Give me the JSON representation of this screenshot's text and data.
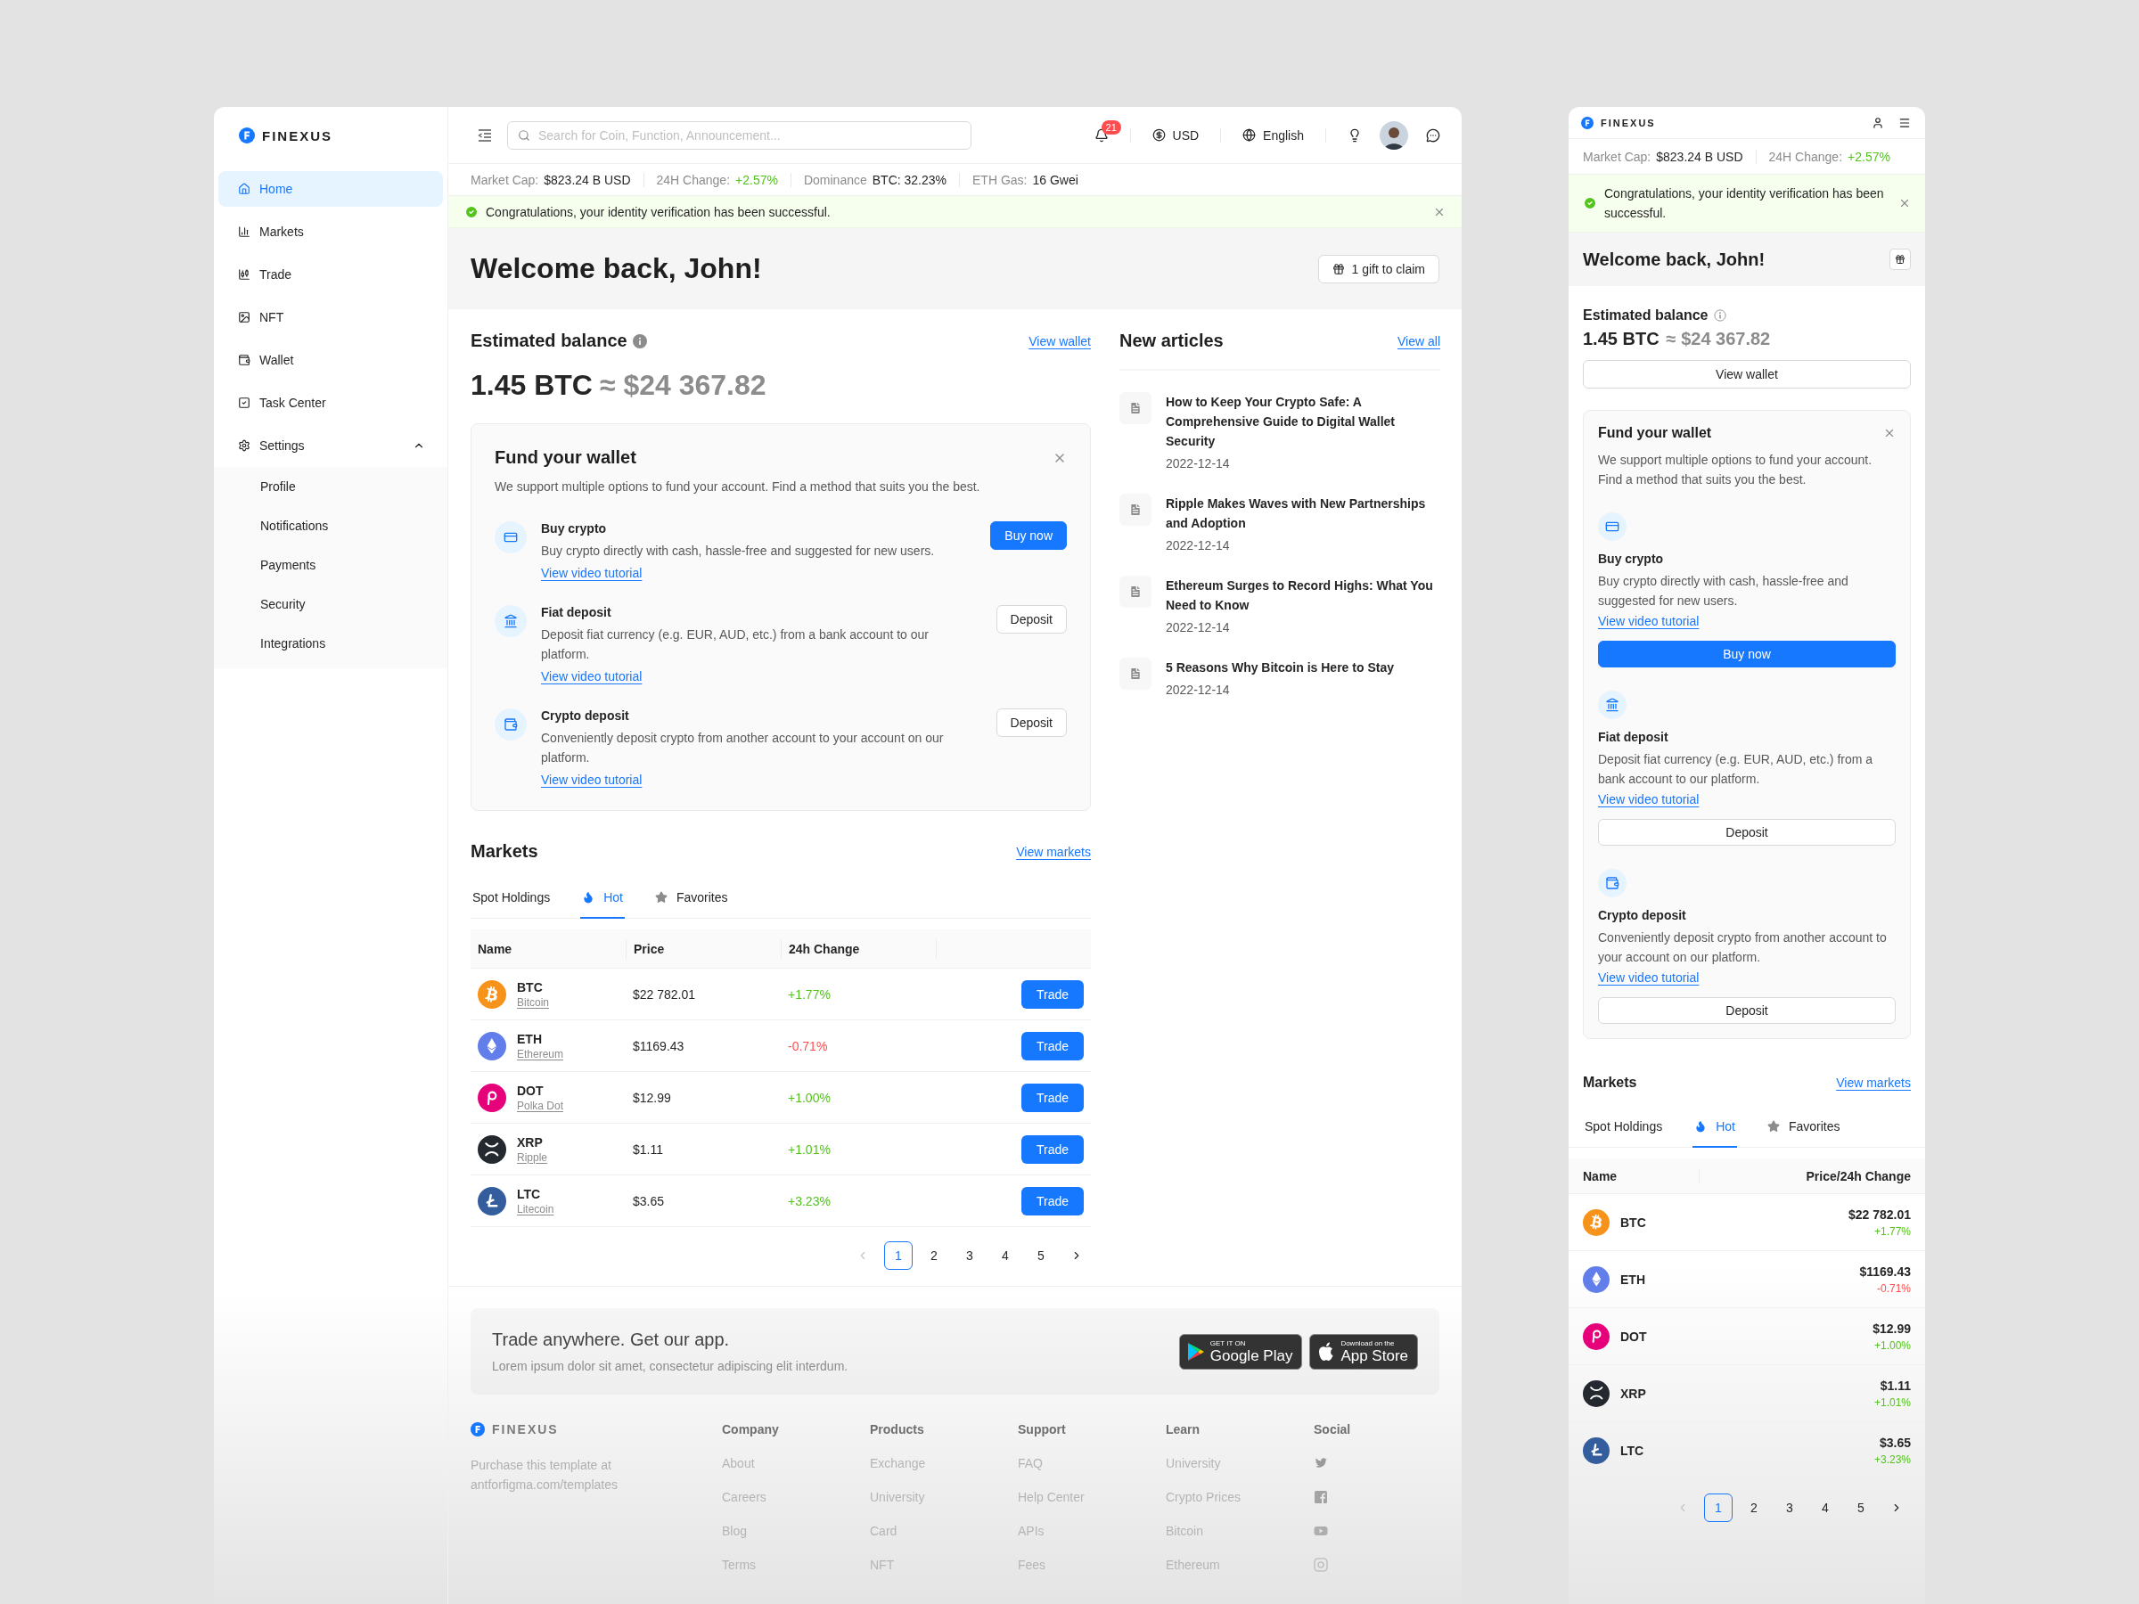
{
  "brand": {
    "name": "FINEXUS"
  },
  "sidebar": {
    "items": [
      {
        "label": "Home",
        "selected": true
      },
      {
        "label": "Markets",
        "selected": false
      },
      {
        "label": "Trade",
        "selected": false
      },
      {
        "label": "NFT",
        "selected": false
      },
      {
        "label": "Wallet",
        "selected": false
      },
      {
        "label": "Task Center",
        "selected": false
      },
      {
        "label": "Settings",
        "selected": false,
        "expanded": true,
        "children": [
          {
            "label": "Profile",
            "selected": false
          },
          {
            "label": "Notifications",
            "selected": false
          },
          {
            "label": "Payments",
            "selected": false
          },
          {
            "label": "Security",
            "selected": false
          },
          {
            "label": "Integrations",
            "selected": false
          }
        ]
      }
    ]
  },
  "header": {
    "search": {
      "placeholder": "Search for Coin, Function, Announcement..."
    },
    "notification_count": "21",
    "currency": "USD",
    "language": "English"
  },
  "ticker": [
    {
      "label": "Market Cap:",
      "value": "$823.24 B USD",
      "kind": "neutral"
    },
    {
      "label": "24H Change:",
      "value": "+2.57%",
      "kind": "up"
    },
    {
      "label": "Dominance",
      "value": "BTC:  32.23%",
      "kind": "neutral"
    },
    {
      "label": "ETH Gas:",
      "value": "16 Gwei",
      "kind": "neutral"
    }
  ],
  "alert": {
    "message": "Congratulations, your identity verification has been successful."
  },
  "welcome": {
    "title": "Welcome back, John!",
    "gift_button": "1 gift to claim"
  },
  "balance": {
    "title": "Estimated balance",
    "link": "View wallet",
    "crypto": "1.45 BTC",
    "approx": "≈",
    "fiat": "$24 367.82"
  },
  "fund": {
    "title": "Fund your wallet",
    "description": "We support multiple options to fund your account. Find a method that suits you the best.",
    "methods": [
      {
        "title": "Buy crypto",
        "description": "Buy crypto directly with cash, hassle-free and suggested for new users.",
        "link": "View video tutorial",
        "button": "Buy now",
        "primary": true
      },
      {
        "title": "Fiat deposit",
        "description": "Deposit fiat currency (e.g. EUR, AUD, etc.) from a bank account to our platform.",
        "link": "View video tutorial",
        "button": "Deposit",
        "primary": false
      },
      {
        "title": "Crypto deposit",
        "description": "Conveniently deposit crypto from another account to your account on our platform.",
        "link": "View video tutorial",
        "button": "Deposit",
        "primary": false
      }
    ]
  },
  "articles": {
    "title": "New articles",
    "link": "View all",
    "items": [
      {
        "title": "How to Keep Your Crypto Safe: A Comprehensive Guide to Digital Wallet Security",
        "date": "2022-12-14"
      },
      {
        "title": "Ripple Makes Waves with New Partnerships and Adoption",
        "date": "2022-12-14"
      },
      {
        "title": "Ethereum Surges to Record Highs: What You Need to Know",
        "date": "2022-12-14"
      },
      {
        "title": "5 Reasons Why Bitcoin is Here to Stay",
        "date": "2022-12-14"
      }
    ]
  },
  "markets": {
    "title": "Markets",
    "link": "View markets",
    "tabs": [
      {
        "label": "Spot Holdings",
        "selected": false
      },
      {
        "label": "Hot",
        "selected": true
      },
      {
        "label": "Favorites",
        "selected": false
      }
    ],
    "columns": [
      "Name",
      "Price",
      "24h Change"
    ],
    "rows": [
      {
        "symbol": "BTC",
        "name": "Bitcoin",
        "price": "$22 782.01",
        "change": "+1.77%",
        "kind": "up",
        "color": "#f7931a",
        "action": "Trade"
      },
      {
        "symbol": "ETH",
        "name": "Ethereum",
        "price": "$1169.43",
        "change": "-0.71%",
        "kind": "down",
        "color": "#627eea",
        "action": "Trade"
      },
      {
        "symbol": "DOT",
        "name": "Polka Dot",
        "price": "$12.99",
        "change": "+1.00%",
        "kind": "up",
        "color": "#e6007a",
        "action": "Trade"
      },
      {
        "symbol": "XRP",
        "name": "Ripple",
        "price": "$1.11",
        "change": "+1.01%",
        "kind": "up",
        "color": "#23292f",
        "action": "Trade"
      },
      {
        "symbol": "LTC",
        "name": "Litecoin",
        "price": "$3.65",
        "change": "+3.23%",
        "kind": "up",
        "color": "#345d9d",
        "action": "Trade"
      }
    ],
    "pagination": {
      "previous_disabled": true,
      "next_disabled": false,
      "pages": [
        {
          "label": "1",
          "selected": true
        },
        {
          "label": "2",
          "selected": false
        },
        {
          "label": "3",
          "selected": false
        },
        {
          "label": "4",
          "selected": false
        },
        {
          "label": "5",
          "selected": false
        }
      ]
    }
  },
  "app_banner": {
    "title": "Trade anywhere. Get our app.",
    "text": "Lorem ipsum dolor sit amet, consectetur adipiscing elit interdum.",
    "stores": [
      {
        "kind": "google",
        "small": "GET IT ON",
        "big": "Google Play"
      },
      {
        "kind": "apple",
        "small": "Download on the",
        "big": "App Store"
      }
    ]
  },
  "footer": {
    "brand": "FINEXUS",
    "note": "Purchase this template at antforfigma.com/templates",
    "columns": [
      {
        "title": "Company",
        "links": [
          "About",
          "Careers",
          "Blog",
          "Terms"
        ]
      },
      {
        "title": "Products",
        "links": [
          "Exchange",
          "University",
          "Card",
          "NFT"
        ]
      },
      {
        "title": "Support",
        "links": [
          "FAQ",
          "Help Center",
          "APIs",
          "Fees"
        ]
      },
      {
        "title": "Learn",
        "links": [
          "University",
          "Crypto Prices",
          "Bitcoin",
          "Ethereum"
        ]
      }
    ],
    "social_title": "Social"
  },
  "mobile": {
    "brand": "FINEXUS",
    "ticker": [
      {
        "label": "Market Cap:",
        "value": "$823.24 B USD",
        "kind": "neutral"
      },
      {
        "label": "24H Change:",
        "value": "+2.57%",
        "kind": "up"
      }
    ],
    "alert": {
      "message": "Congratulations, your identity verification has been successful."
    },
    "welcome": {
      "title": "Welcome back, John!"
    },
    "balance": {
      "title": "Estimated balance",
      "crypto": "1.45 BTC",
      "approx": "≈",
      "fiat": "$24 367.82",
      "button": "View wallet"
    },
    "fund": {
      "title": "Fund your wallet",
      "description": "We support multiple options to fund your account. Find a method that suits you the best.",
      "methods": [
        {
          "title": "Buy crypto",
          "description": "Buy crypto directly with cash, hassle-free and suggested for new users.",
          "link": "View video tutorial",
          "button": "Buy now",
          "primary": true
        },
        {
          "title": "Fiat deposit",
          "description": "Deposit fiat currency (e.g. EUR, AUD, etc.) from a bank account to our platform.",
          "link": "View video tutorial",
          "button": "Deposit",
          "primary": false
        },
        {
          "title": "Crypto deposit",
          "description": "Conveniently deposit crypto from another account to your account on our platform.",
          "link": "View video tutorial",
          "button": "Deposit",
          "primary": false
        }
      ]
    },
    "markets": {
      "title": "Markets",
      "link": "View markets",
      "tabs": [
        {
          "label": "Spot Holdings",
          "selected": false
        },
        {
          "label": "Hot",
          "selected": true
        },
        {
          "label": "Favorites",
          "selected": false
        }
      ],
      "columns": [
        "Name",
        "Price/24h Change"
      ],
      "rows": [
        {
          "symbol": "BTC",
          "price": "$22 782.01",
          "change": "+1.77%",
          "kind": "up",
          "color": "#f7931a"
        },
        {
          "symbol": "ETH",
          "price": "$1169.43",
          "change": "-0.71%",
          "kind": "down",
          "color": "#627eea"
        },
        {
          "symbol": "DOT",
          "price": "$12.99",
          "change": "+1.00%",
          "kind": "up",
          "color": "#e6007a"
        },
        {
          "symbol": "XRP",
          "price": "$1.11",
          "change": "+1.01%",
          "kind": "up",
          "color": "#23292f"
        },
        {
          "symbol": "LTC",
          "price": "$3.65",
          "change": "+3.23%",
          "kind": "up",
          "color": "#345d9d"
        }
      ],
      "pagination": {
        "previous_disabled": true,
        "next_disabled": false,
        "pages": [
          {
            "label": "1",
            "selected": true
          },
          {
            "label": "2",
            "selected": false
          },
          {
            "label": "3",
            "selected": false
          },
          {
            "label": "4",
            "selected": false
          },
          {
            "label": "5",
            "selected": false
          }
        ]
      }
    }
  }
}
